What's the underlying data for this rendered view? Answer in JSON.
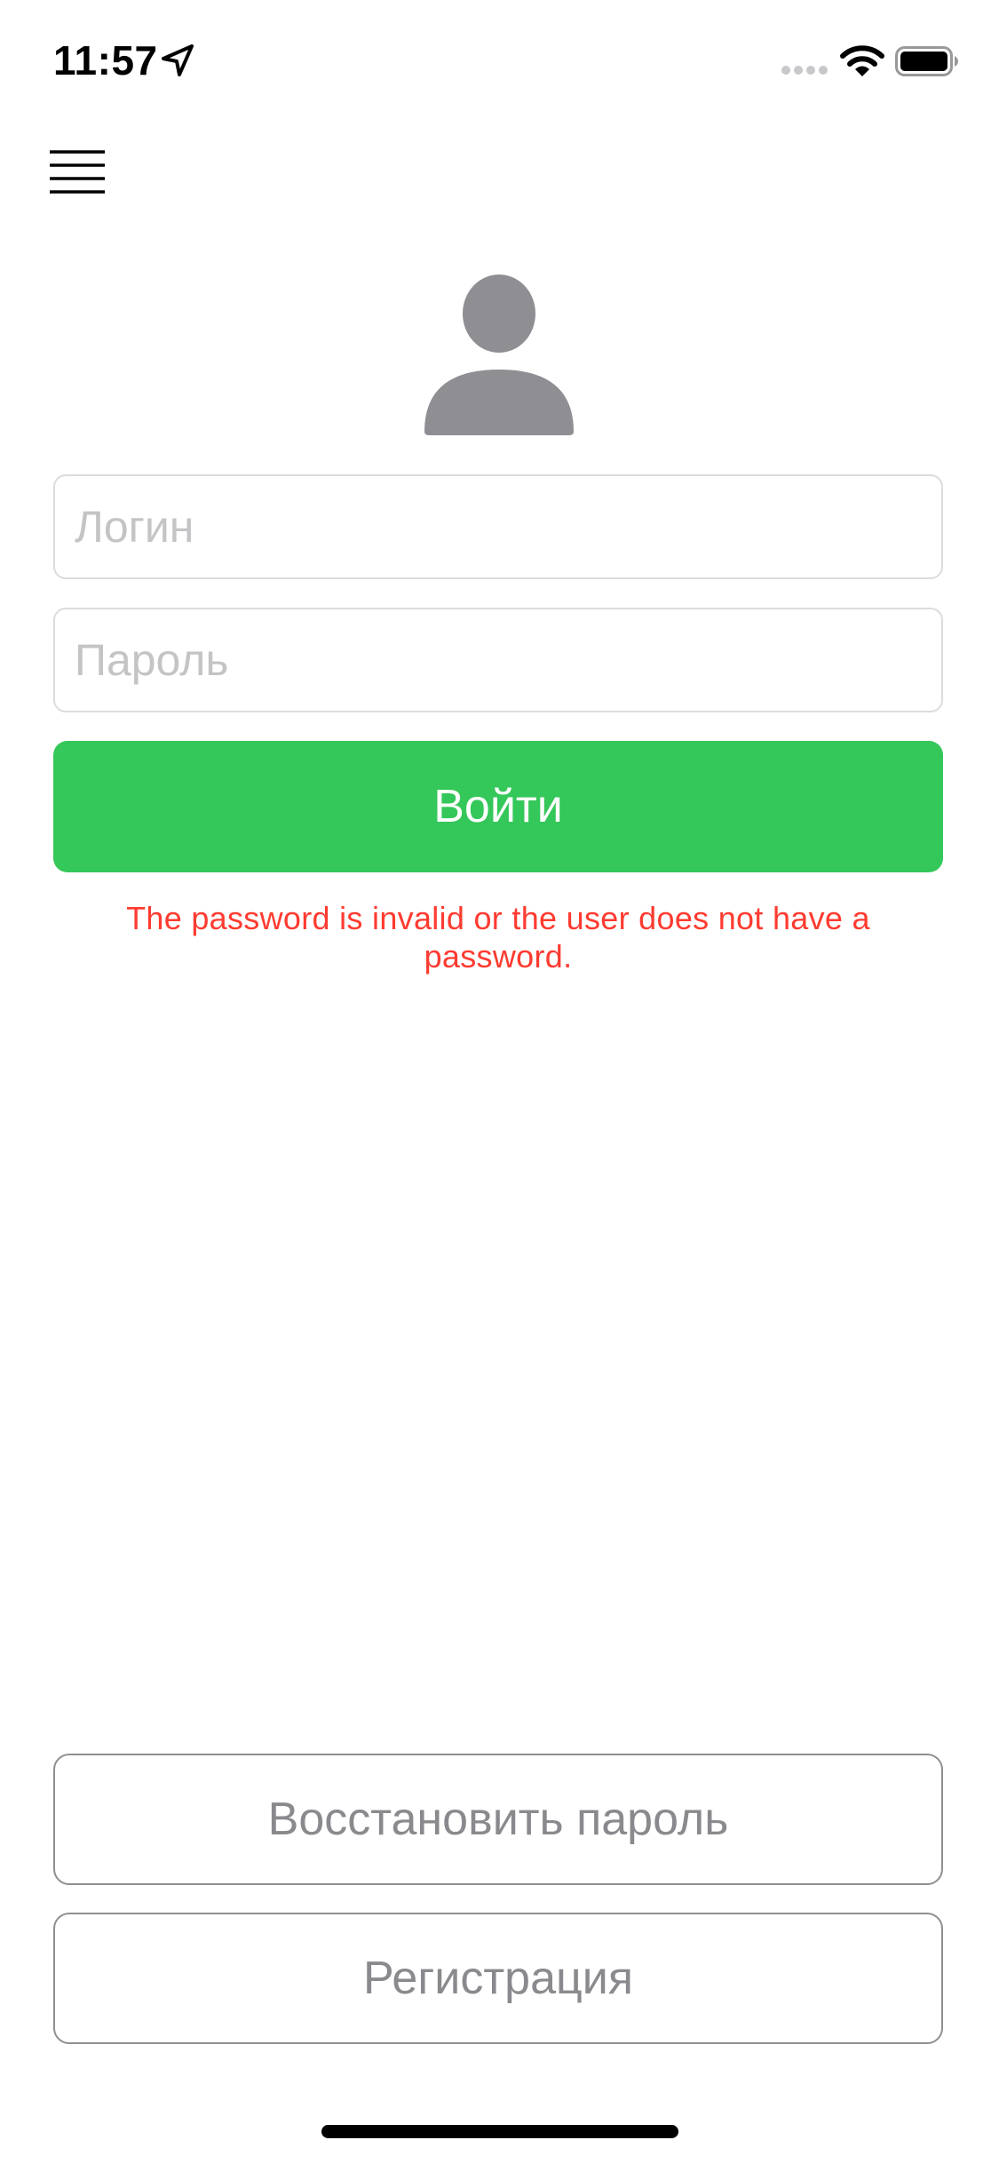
{
  "status_bar": {
    "time": "11:57",
    "icons": [
      "location-arrow-icon",
      "signal-icon",
      "wifi-icon",
      "battery-icon"
    ]
  },
  "menu": {
    "icon": "menu-icon"
  },
  "avatar": {
    "icon": "user-avatar-icon",
    "color": "#8e8e93"
  },
  "form": {
    "login_placeholder": "Логин",
    "login_value": "",
    "password_placeholder": "Пароль",
    "password_value": "",
    "submit_label": "Войти",
    "error_message": "The password is invalid or the user does not have a password."
  },
  "footer": {
    "restore_label": "Восстановить пароль",
    "register_label": "Регистрация"
  },
  "colors": {
    "accent": "#34c759",
    "error": "#ff3b30",
    "secondary_text": "#8a8a8e",
    "field_border": "#dcdcdc"
  }
}
